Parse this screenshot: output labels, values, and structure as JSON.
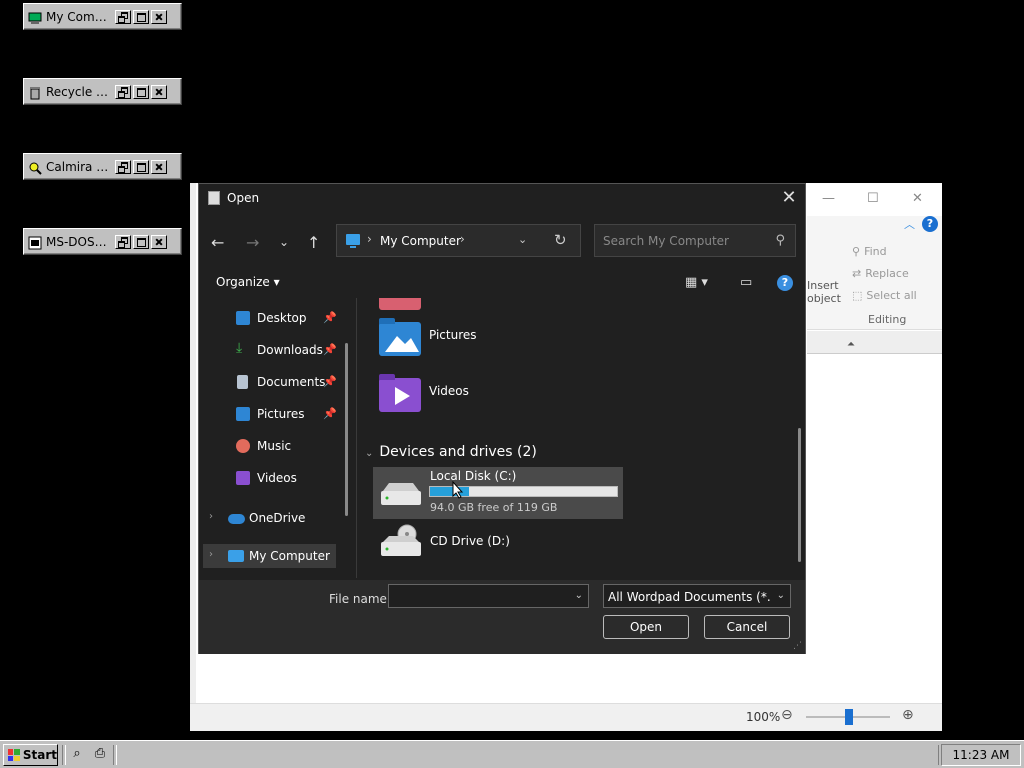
{
  "desktop_windows": [
    {
      "title": "My Comp...",
      "icon": "computer-icon"
    },
    {
      "title": "Recycle Bin",
      "icon": "recycle-bin-icon"
    },
    {
      "title": "Calmira E...",
      "icon": "explorer-icon"
    },
    {
      "title": "MS-DOS P...",
      "icon": "dos-icon"
    }
  ],
  "wordpad": {
    "ribbon": {
      "insert_object": "Insert object",
      "find": "Find",
      "replace": "Replace",
      "select_all": "Select all",
      "group": "Editing"
    },
    "zoom": "100%"
  },
  "dialog": {
    "title": "Open",
    "address": "My Computer",
    "search_placeholder": "Search My Computer",
    "organize": "Organize",
    "sidebar": [
      {
        "label": "Desktop",
        "icon": "desktop-icon",
        "pinned": true
      },
      {
        "label": "Downloads",
        "icon": "download-icon",
        "pinned": true
      },
      {
        "label": "Documents",
        "icon": "documents-icon",
        "pinned": true
      },
      {
        "label": "Pictures",
        "icon": "pictures-icon",
        "pinned": true
      },
      {
        "label": "Music",
        "icon": "music-icon",
        "pinned": false
      },
      {
        "label": "Videos",
        "icon": "videos-icon",
        "pinned": false
      },
      {
        "label": "OneDrive",
        "icon": "cloud-icon",
        "pinned": false
      },
      {
        "label": "My Computer",
        "icon": "computer-icon",
        "pinned": false,
        "selected": true
      }
    ],
    "folders": [
      {
        "label": "Pictures",
        "icon": "pictures-folder-icon"
      },
      {
        "label": "Videos",
        "icon": "videos-folder-icon"
      }
    ],
    "devices_header": "Devices and drives (2)",
    "drives": [
      {
        "label": "Local Disk (C:)",
        "free_text": "94.0 GB free of 119 GB",
        "used_fraction": 0.21,
        "icon": "hard-drive-icon"
      },
      {
        "label": "CD Drive (D:)",
        "icon": "cd-drive-icon"
      }
    ],
    "file_name_label": "File name:",
    "file_name_value": "",
    "file_type": "All Wordpad Documents (*.rtf, ",
    "open_button": "Open",
    "cancel_button": "Cancel"
  },
  "taskbar": {
    "start_label": "Start",
    "clock": "11:23 AM"
  },
  "colors": {
    "accent": "#3a8fe0",
    "dialog_bg": "#202020",
    "win98_gray": "#c0c0c0"
  }
}
